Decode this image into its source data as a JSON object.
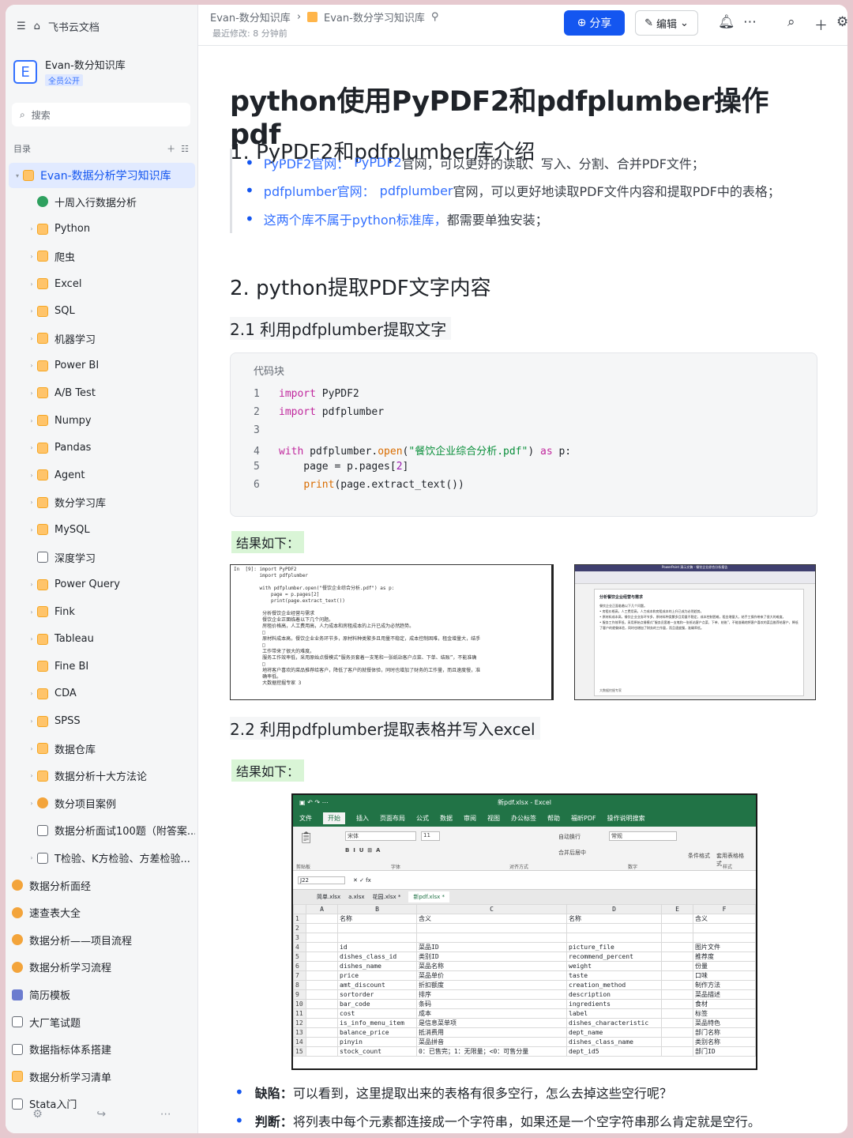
{
  "app": {
    "name": "飞书云文档"
  },
  "sidebar": {
    "kb_logo": "E",
    "kb_name": "Evan-数分知识库",
    "kb_badge": "全员公开",
    "search_placeholder": "搜索",
    "toc_label": "目录",
    "items": [
      {
        "label": "Evan-数据分析学习知识库",
        "icon": "folder",
        "arrow": "▾",
        "selected": true
      },
      {
        "label": "十周入行数据分析",
        "icon": "globe",
        "arrow": ""
      },
      {
        "label": "Python",
        "icon": "folder",
        "arrow": "›"
      },
      {
        "label": "爬虫",
        "icon": "folder",
        "arrow": "›"
      },
      {
        "label": "Excel",
        "icon": "folder",
        "arrow": "›"
      },
      {
        "label": "SQL",
        "icon": "folder",
        "arrow": "›"
      },
      {
        "label": "机器学习",
        "icon": "folder",
        "arrow": "›"
      },
      {
        "label": "Power BI",
        "icon": "folder",
        "arrow": "›"
      },
      {
        "label": "A/B Test",
        "icon": "folder",
        "arrow": "›"
      },
      {
        "label": "Numpy",
        "icon": "folder",
        "arrow": "›"
      },
      {
        "label": "Pandas",
        "icon": "folder",
        "arrow": "›"
      },
      {
        "label": "Agent",
        "icon": "folder",
        "arrow": "›"
      },
      {
        "label": "数分学习库",
        "icon": "folder",
        "arrow": "›"
      },
      {
        "label": "MySQL",
        "icon": "folder",
        "arrow": "›"
      },
      {
        "label": "深度学习",
        "icon": "doc",
        "arrow": ""
      },
      {
        "label": "Power Query",
        "icon": "folder",
        "arrow": "›"
      },
      {
        "label": "Fink",
        "icon": "folder",
        "arrow": "›"
      },
      {
        "label": "Tableau",
        "icon": "folder",
        "arrow": "›"
      },
      {
        "label": "Fine BI",
        "icon": "folder",
        "arrow": ""
      },
      {
        "label": "CDA",
        "icon": "folder",
        "arrow": "›"
      },
      {
        "label": "SPSS",
        "icon": "folder",
        "arrow": "›"
      },
      {
        "label": "数据仓库",
        "icon": "folder",
        "arrow": "›"
      },
      {
        "label": "数据分析十大方法论",
        "icon": "folder",
        "arrow": "›"
      },
      {
        "label": "数分项目案例",
        "icon": "emo",
        "arrow": "›"
      },
      {
        "label": "数据分析面试100题（附答案...",
        "icon": "doc",
        "arrow": ""
      },
      {
        "label": "T检验、K方检验、方差检验...",
        "icon": "doc",
        "arrow": "›"
      },
      {
        "label": "数据分析面经",
        "icon": "emo",
        "arrow": "",
        "level": 0
      },
      {
        "label": "速查表大全",
        "icon": "emo",
        "arrow": "",
        "level": 0
      },
      {
        "label": "数据分析——项目流程",
        "icon": "emo",
        "arrow": "",
        "level": 0
      },
      {
        "label": "数据分析学习流程",
        "icon": "emo",
        "arrow": "",
        "level": 0
      },
      {
        "label": "简历模板",
        "icon": "sbar",
        "arrow": "",
        "level": 0
      },
      {
        "label": "大厂笔试题",
        "icon": "doc",
        "arrow": "",
        "level": 0
      },
      {
        "label": "数据指标体系搭建",
        "icon": "doc",
        "arrow": "",
        "level": 0
      },
      {
        "label": "数据分析学习清单",
        "icon": "folder",
        "arrow": "",
        "level": 0
      },
      {
        "label": "Stata入门",
        "icon": "doc",
        "arrow": "",
        "level": 0
      }
    ]
  },
  "header": {
    "breadcrumb_1": "Evan-数分知识库",
    "breadcrumb_2": "Evan-数分学习知识库",
    "modified": "最近修改: 8 分钟前",
    "share": "分享",
    "edit": "编辑"
  },
  "doc": {
    "title": "python使用PyPDF2和pdfplumber操作pdf",
    "h1_intro": "1. PyPDF2和pdfplumber库介绍",
    "bullets": [
      {
        "link": "PyPDF2官网：",
        "link2": "PyPDF2",
        "text": "官网，可以更好的读取、写入、分割、合并PDF文件；"
      },
      {
        "link": "pdfplumber官网：",
        "link2": "pdfplumber",
        "text": "官网，可以更好地读取PDF文件内容和提取PDF中的表格；"
      },
      {
        "link": "这两个库不属于python标准库，",
        "link2": "",
        "text": "都需要单独安装；"
      }
    ],
    "h2_extract": "2. python提取PDF文字内容",
    "h3_text": "2.1 利用pdfplumber提取文字",
    "code_label": "代码块",
    "code_lines": [
      {
        "n": "1",
        "text": "import PyPDF2"
      },
      {
        "n": "2",
        "text": "import pdfplumber"
      },
      {
        "n": "3",
        "text": ""
      },
      {
        "n": "4",
        "text": "with pdfplumber.open(\"餐饮企业综合分析.pdf\") as p:"
      },
      {
        "n": "5",
        "text": "    page = p.pages[2]"
      },
      {
        "n": "6",
        "text": "    print(page.extract_text())"
      }
    ],
    "result_label": "结果如下：",
    "h3_table": "2.2 利用pdfplumber提取表格并写入excel",
    "defect_label": "缺陷：",
    "defect_text": "可以看到，这里提取出来的表格有很多空行，怎么去掉这些空行呢？",
    "judge_label": "判断：",
    "judge_text": "将列表中每个元素都连接成一个字符串，如果还是一个空字符串那么肯定就是空行。"
  },
  "shot1": {
    "lines": "In  [9]: import PyPDF2\n         import pdfplumber\n\n         with pdfplumber.open(\"餐饮企业综合分析.pdf\") as p:\n             page = p.pages[2]\n             print(page.extract_text())\n\n          分析餐饮企业经营与需求\n          餐饮企业正面临着以下几个问题。\n          房租价格高，人工费用高，人力成本和房租成本的上升已成为必然趋势。\n          □\n          原材料成本高，餐饮企业业务环节多，原材料种类繁多且用量不稳定，成本控制困难，租金增量大，结手\n          □\n          工作带来了很大的难度。\n          服务工作效率低，采用原始点餐模式“服务员套着一支笔和一张纸站客户点菜、下单、结账”，不能准确\n          □\n          地将客户喜欢的菜品推荐给客户，降低了客户的就餐体验，同时也增加了财务的工作量，而且速度慢，准\n          确率低。\n          大数据挖掘专家 3"
  },
  "shot2": {
    "title": "PowerPoint 演示文稿 - 餐饮企业综合分析报告",
    "heading": "分析餐饮企业经营与需求",
    "body": "餐饮企业正面临着以下几个问题。\n• 房租价格高，人工费用高，人力成本和房租成本的上升已成为必然趋势。\n• 原材料成本高，餐饮企业业务环节多，原材料种类繁多且用量不稳定，成本控制困难，租金增量大，结手工操作带来了很大的难度。\n• 服务工作效率低，采用原始点餐模式“服务员套着一支笔和一张纸站客户点菜、下单、结账”，不能准确地将客户喜欢的菜品推荐给客户，降低了客户的就餐体验，同时也增加了财务的工作量，而且速度慢，准确率低。",
    "footer": "大数据挖掘专家"
  },
  "excel": {
    "title": "新pdf.xlsx  -  Excel",
    "tabs": [
      "文件",
      "开始",
      "插入",
      "页面布局",
      "公式",
      "数据",
      "审阅",
      "视图",
      "办公标签",
      "帮助",
      "福昕PDF",
      "操作说明搜索"
    ],
    "font": "宋体",
    "font_size": "11",
    "wrap": "自动换行",
    "merge": "合并后居中",
    "number_format": "常规",
    "groups": [
      "剪贴板",
      "字体",
      "对齐方式",
      "数字",
      "样式"
    ],
    "cond_format": "条件格式",
    "table_format": "套用表格格式",
    "cell_name": "J22",
    "workbooks": [
      "简单.xlsx",
      "a.xlsx",
      "花园.xlsx *",
      "新pdf.xlsx *"
    ],
    "col_headers": [
      "",
      "A",
      "B",
      "C",
      "D",
      "E",
      "F"
    ],
    "rows": [
      [
        "1",
        "",
        "名称",
        "含义",
        "名称",
        "",
        "含义"
      ],
      [
        "2",
        "",
        "",
        "",
        "",
        "",
        ""
      ],
      [
        "3",
        "",
        "",
        "",
        "",
        "",
        ""
      ],
      [
        "4",
        "",
        "id",
        "菜品ID",
        "picture_file",
        "",
        "图片文件"
      ],
      [
        "5",
        "",
        "dishes_class_id",
        "类别ID",
        "recommend_percent",
        "",
        "推荐度"
      ],
      [
        "6",
        "",
        "dishes_name",
        "菜品名称",
        "weight",
        "",
        "份量"
      ],
      [
        "7",
        "",
        "price",
        "菜品单价",
        "taste",
        "",
        "口味"
      ],
      [
        "8",
        "",
        "amt_discount",
        "折扣额度",
        "creation_method",
        "",
        "制作方法"
      ],
      [
        "9",
        "",
        "sortorder",
        "排序",
        "description",
        "",
        "菜品描述"
      ],
      [
        "10",
        "",
        "bar_code",
        "条码",
        "ingredients",
        "",
        "食材"
      ],
      [
        "11",
        "",
        "cost",
        "成本",
        "label",
        "",
        "标签"
      ],
      [
        "12",
        "",
        "is_info_menu_item",
        "是信息菜单项",
        "dishes_characteristic",
        "",
        "菜品特色"
      ],
      [
        "13",
        "",
        "balance_price",
        "抵消费用",
        "dept_name",
        "",
        "部门名称"
      ],
      [
        "14",
        "",
        "pinyin",
        "菜品拼音",
        "dishes_class_name",
        "",
        "类别名称"
      ],
      [
        "15",
        "",
        "stock_count",
        "0：已售完；1：无限量；<0：可售分量",
        "dept_id5",
        "",
        "部门ID"
      ]
    ]
  },
  "colors": {
    "accent": "#1456f0",
    "excel_green": "#217346",
    "highlight": "#d9f5d6"
  }
}
